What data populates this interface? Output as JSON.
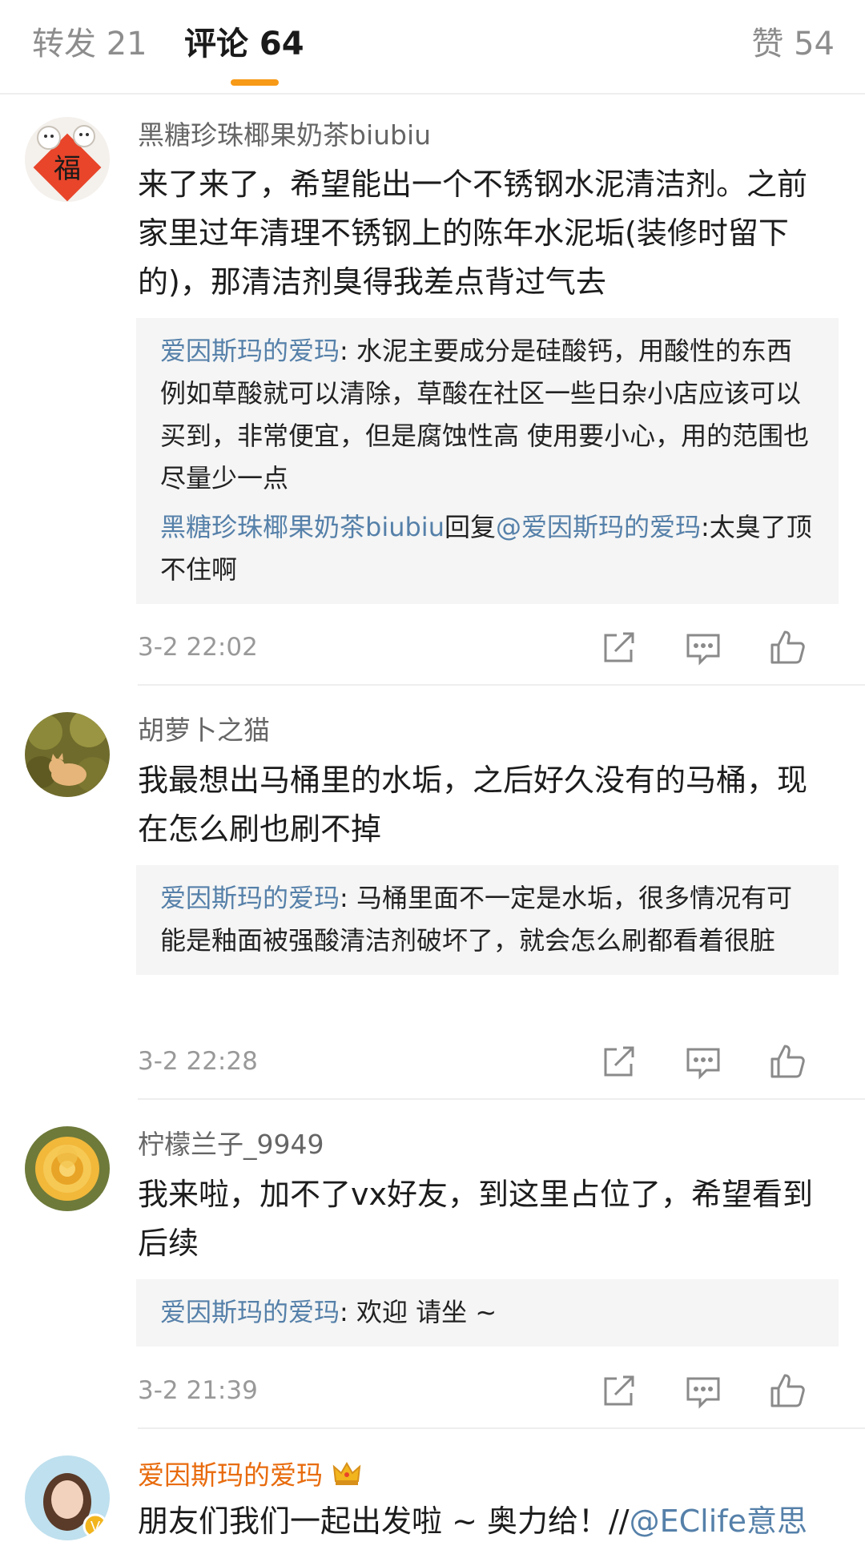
{
  "tabs": {
    "repost": "转发 21",
    "comments": "评论 64",
    "likes": "赞 54"
  },
  "comments": [
    {
      "username": "黑糖珍珠椰果奶茶biubiu",
      "avatar_icon": "fu-character-avatar-icon",
      "text": "来了来了，希望能出一个不锈钢水泥清洁剂。之前家里过年清理不锈钢上的陈年水泥垢(装修时留下的)，那清洁剂臭得我差点背过气去",
      "replies": [
        {
          "name": "爱因斯玛的爱玛",
          "sep": ": ",
          "text": "水泥主要成分是硅酸钙，用酸性的东西例如草酸就可以清除，草酸在社区一些日杂小店应该可以买到，非常便宜，但是腐蚀性高 使用要小心，用的范围也尽量少一点"
        },
        {
          "name": "黑糖珍珠椰果奶茶biubiu",
          "mid": "回复",
          "mention": "@爱因斯玛的爱玛",
          "sep": ":",
          "text": "太臭了顶不住啊"
        }
      ],
      "time": "3-2 22:02"
    },
    {
      "username": "胡萝卜之猫",
      "avatar_icon": "cat-avatar-icon",
      "text": "我最想出马桶里的水垢，之后好久没有的马桶，现在怎么刷也刷不掉",
      "replies": [
        {
          "name": "爱因斯玛的爱玛",
          "sep": ": ",
          "text": "马桶里面不一定是水垢，很多情况有可能是釉面被强酸清洁剂破坏了，就会怎么刷都看着很脏"
        }
      ],
      "time": "3-2 22:28"
    },
    {
      "username": "柠檬兰子_9949",
      "avatar_icon": "rose-avatar-icon",
      "text": "我来啦，加不了vx好友，到这里占位了，希望看到后续",
      "replies": [
        {
          "name": "爱因斯玛的爱玛",
          "sep": ": ",
          "text": "欢迎 请坐 ~"
        }
      ],
      "time": "3-2 21:39"
    },
    {
      "username": "爱因斯玛的爱玛",
      "avatar_icon": "woman-avatar-icon",
      "badge_icon": "crown-badge-icon",
      "text": "朋友们我们一起出发啦 ~ 奥力给！//",
      "mention": "@EClife意思"
    }
  ],
  "colors": {
    "accent": "#f79a17",
    "link": "#5580a9",
    "author_name": "#e86b0d",
    "reply_bg": "#f5f5f5"
  }
}
